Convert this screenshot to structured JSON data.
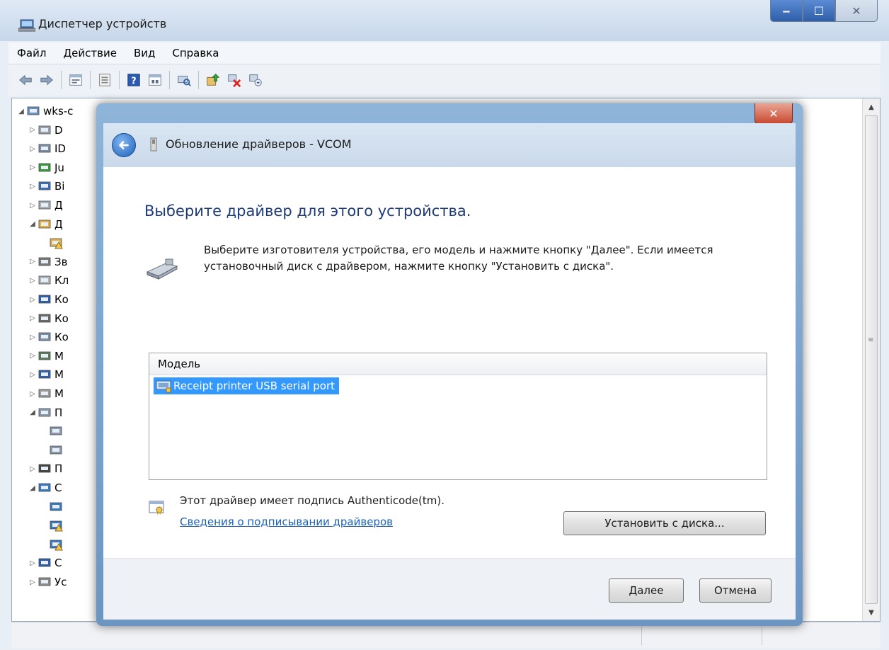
{
  "window": {
    "title": "Диспетчер устройств",
    "buttons": {
      "minimize": "‒",
      "maximize": "☐",
      "close": "✕"
    }
  },
  "menu": [
    "Файл",
    "Действие",
    "Вид",
    "Справка"
  ],
  "toolbar": {
    "icons": [
      "back-arrow-icon",
      "forward-arrow-icon",
      "properties-icon",
      "view-icon",
      "help-icon",
      "show-hidden-icon",
      "scan-hardware-icon",
      "update-driver-icon",
      "uninstall-icon",
      "disable-icon"
    ]
  },
  "tree": {
    "items": [
      {
        "label": "wks-c",
        "expander": "◢",
        "depth": 0,
        "icon": "computer-icon"
      },
      {
        "label": "D",
        "expander": "▷",
        "depth": 1,
        "icon": "dvd-drive-icon"
      },
      {
        "label": "ID",
        "expander": "▷",
        "depth": 1,
        "icon": "ide-controller-icon"
      },
      {
        "label": "Ju",
        "expander": "▷",
        "depth": 1,
        "icon": "jungo-icon"
      },
      {
        "label": "Ві",
        "expander": "▷",
        "depth": 1,
        "icon": "display-adapter-icon"
      },
      {
        "label": "Д",
        "expander": "▷",
        "depth": 1,
        "icon": "disk-drive-icon"
      },
      {
        "label": "Д",
        "expander": "◢",
        "depth": 1,
        "icon": "unknown-device-icon"
      },
      {
        "label": "",
        "expander": "",
        "depth": 2,
        "icon": "unknown-device-warning-icon"
      },
      {
        "label": "Зв",
        "expander": "▷",
        "depth": 1,
        "icon": "speaker-icon"
      },
      {
        "label": "Кл",
        "expander": "▷",
        "depth": 1,
        "icon": "keyboard-icon"
      },
      {
        "label": "Ко",
        "expander": "▷",
        "depth": 1,
        "icon": "monitor-icon"
      },
      {
        "label": "Ко",
        "expander": "▷",
        "depth": 1,
        "icon": "usb-icon"
      },
      {
        "label": "Ко",
        "expander": "▷",
        "depth": 1,
        "icon": "storage-controller-icon"
      },
      {
        "label": "М",
        "expander": "▷",
        "depth": 1,
        "icon": "memory-icon"
      },
      {
        "label": "М",
        "expander": "▷",
        "depth": 1,
        "icon": "monitor-icon"
      },
      {
        "label": "М",
        "expander": "▷",
        "depth": 1,
        "icon": "mouse-icon"
      },
      {
        "label": "П",
        "expander": "◢",
        "depth": 1,
        "icon": "port-icon"
      },
      {
        "label": "",
        "expander": "",
        "depth": 2,
        "icon": "port-icon"
      },
      {
        "label": "",
        "expander": "",
        "depth": 2,
        "icon": "port-icon"
      },
      {
        "label": "П",
        "expander": "▷",
        "depth": 1,
        "icon": "processor-icon"
      },
      {
        "label": "С",
        "expander": "◢",
        "depth": 1,
        "icon": "network-icon"
      },
      {
        "label": "",
        "expander": "",
        "depth": 2,
        "icon": "network-adapter-icon"
      },
      {
        "label": "",
        "expander": "",
        "depth": 2,
        "icon": "network-adapter-warning-icon"
      },
      {
        "label": "",
        "expander": "",
        "depth": 2,
        "icon": "network-adapter-warning-icon"
      },
      {
        "label": "С",
        "expander": "▷",
        "depth": 1,
        "icon": "system-device-icon"
      },
      {
        "label": "Ус",
        "expander": "▷",
        "depth": 1,
        "icon": "hid-icon"
      }
    ]
  },
  "dialog": {
    "title": "Обновление драйверов - VCOM",
    "close": "✕",
    "instruction": "Выберите драйвер для этого устройства.",
    "description": "Выберите изготовителя устройства, его модель и нажмите кнопку \"Далее\". Если имеется установочный диск с  драйвером, нажмите кнопку \"Установить с диска\".",
    "list": {
      "header": "Модель",
      "items": [
        {
          "label": "Receipt printer USB serial port",
          "selected": true
        }
      ]
    },
    "signature_text": "Этот драйвер имеет подпись Authenticode(tm).",
    "signature_link": "Сведения о подписывании драйверов",
    "install_button": "Установить с диска...",
    "next_button": "Далее",
    "cancel_button": "Отмена"
  },
  "colors": {
    "selection": "#3399ff",
    "instruction_text": "#1e3b78",
    "link": "#1c5fb8",
    "dialog_frame": "#7ea6d0"
  }
}
